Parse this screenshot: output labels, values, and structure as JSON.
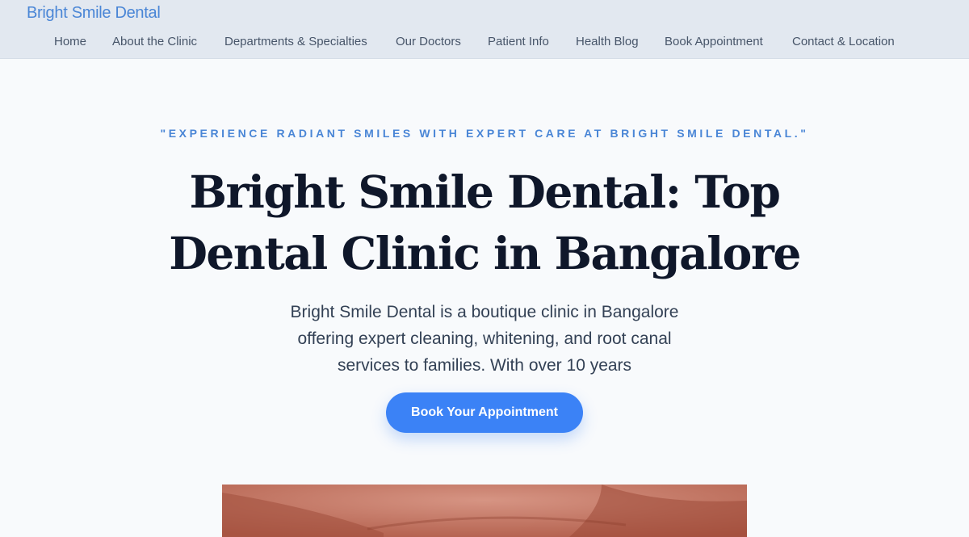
{
  "header": {
    "brand": "Bright Smile Dental",
    "nav": [
      {
        "label": "Home"
      },
      {
        "label": "About the Clinic"
      },
      {
        "label": "Departments & Specialties"
      },
      {
        "label": "Our Doctors"
      },
      {
        "label": "Patient Info"
      },
      {
        "label": "Health Blog"
      },
      {
        "label": "Book Appointment"
      },
      {
        "label": "Contact & Location"
      }
    ]
  },
  "hero": {
    "tagline": "\"EXPERIENCE RADIANT SMILES WITH EXPERT CARE AT BRIGHT SMILE DENTAL.\"",
    "title": "Bright Smile Dental: Top Dental Clinic in Bangalore",
    "description": "Bright Smile Dental is a boutique clinic in Bangalore offering expert cleaning, whitening, and root canal services to families. With over 10 years",
    "cta_label": "Book Your Appointment"
  },
  "colors": {
    "brand": "#4a86d6",
    "accent": "#3b82f6",
    "header_bg": "#e2e8f0",
    "page_bg": "#f8fafc",
    "heading": "#0f172a"
  }
}
